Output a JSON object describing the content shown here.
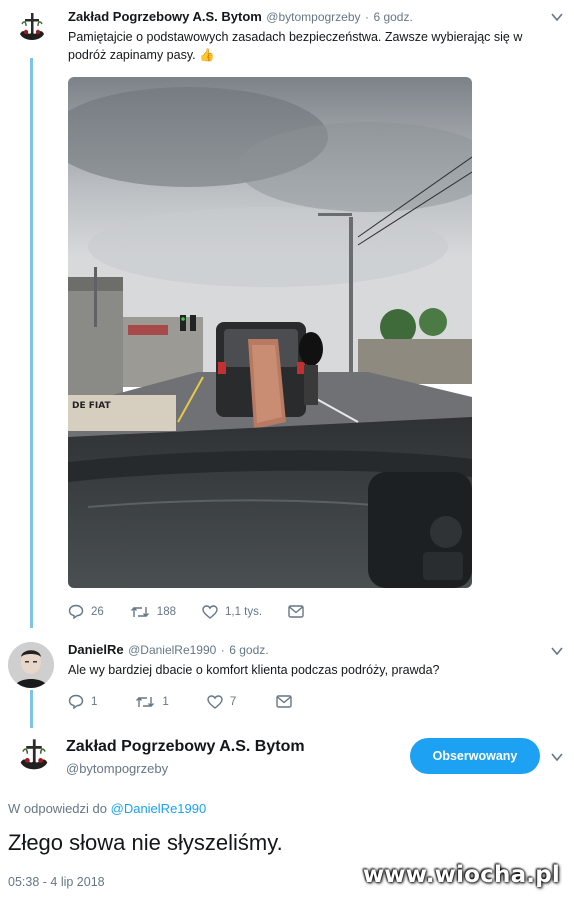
{
  "tweet1": {
    "name": "Zakład Pogrzebowy A.S. Bytom",
    "handle": "@bytompogrzeby",
    "separator": "·",
    "time": "6 godz.",
    "text_line1": "Pamiętajcie o podstawowych zasadach bezpieczeństwa. Zawsze wybierając się w",
    "text_line2": "podróż zapinamy pasy.",
    "emoji": "👍",
    "media_sign_text": "DE FIAT",
    "replies": "26",
    "retweets": "188",
    "likes": "1,1 tys."
  },
  "tweet2": {
    "name": "DanielRe",
    "handle": "@DanielRe1990",
    "separator": "·",
    "time": "6 godz.",
    "text": "Ale wy bardziej dbacie o komfort klienta podczas podróży, prawda?",
    "replies": "1",
    "retweets": "1",
    "likes": "7"
  },
  "tweet3": {
    "name": "Zakład Pogrzebowy A.S. Bytom",
    "handle": "@bytompogrzeby",
    "follow_label": "Obserwowany",
    "reply_to_prefix": "W odpowiedzi do",
    "reply_to_handle": "@DanielRe1990",
    "text": "Złego słowa nie słyszeliśmy.",
    "timestamp": "05:38 - 4 lip 2018"
  },
  "watermark": "www.wiocha.pl",
  "colors": {
    "accent": "#1da1f2",
    "thread_line": "#7fc4e8",
    "secondary_text": "#657786"
  }
}
